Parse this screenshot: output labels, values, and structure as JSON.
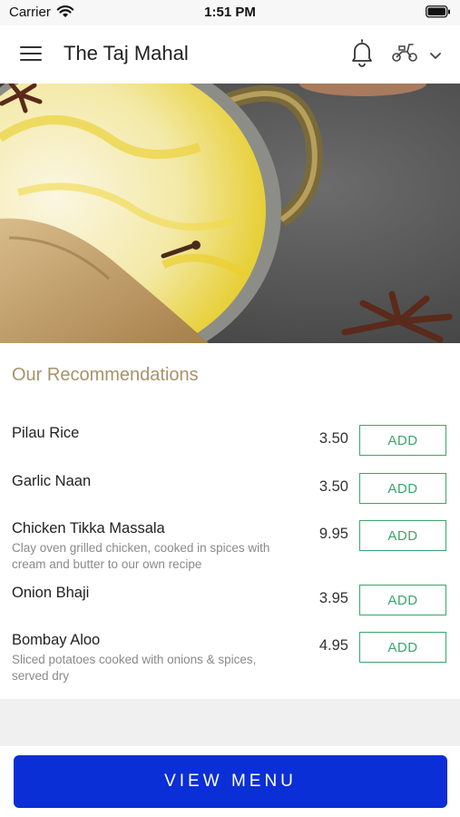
{
  "status_bar": {
    "carrier": "Carrier",
    "time": "1:51 PM"
  },
  "header": {
    "title": "The Taj Mahal"
  },
  "icons": {
    "menu": "hamburger-menu-icon",
    "notifications": "bell-icon",
    "delivery": "scooter-icon",
    "dropdown": "chevron-down-icon"
  },
  "recommendations": {
    "title": "Our Recommendations",
    "items": [
      {
        "name": "Pilau Rice",
        "description": "",
        "price": "3.50",
        "action": "ADD"
      },
      {
        "name": "Garlic Naan",
        "description": "",
        "price": "3.50",
        "action": "ADD"
      },
      {
        "name": "Chicken Tikka Massala",
        "description": "Clay oven grilled chicken, cooked in spices with cream and butter to our own recipe",
        "price": "9.95",
        "action": "ADD"
      },
      {
        "name": "Onion Bhaji",
        "description": "",
        "price": "3.95",
        "action": "ADD"
      },
      {
        "name": "Bombay Aloo",
        "description": "Sliced potatoes cooked with onions & spices, served dry",
        "price": "4.95",
        "action": "ADD"
      }
    ]
  },
  "footer": {
    "view_menu_label": "VIEW MENU"
  },
  "colors": {
    "accent_gold": "#a8926a",
    "add_green": "#3aa66a",
    "primary_blue": "#0a2fd6"
  }
}
